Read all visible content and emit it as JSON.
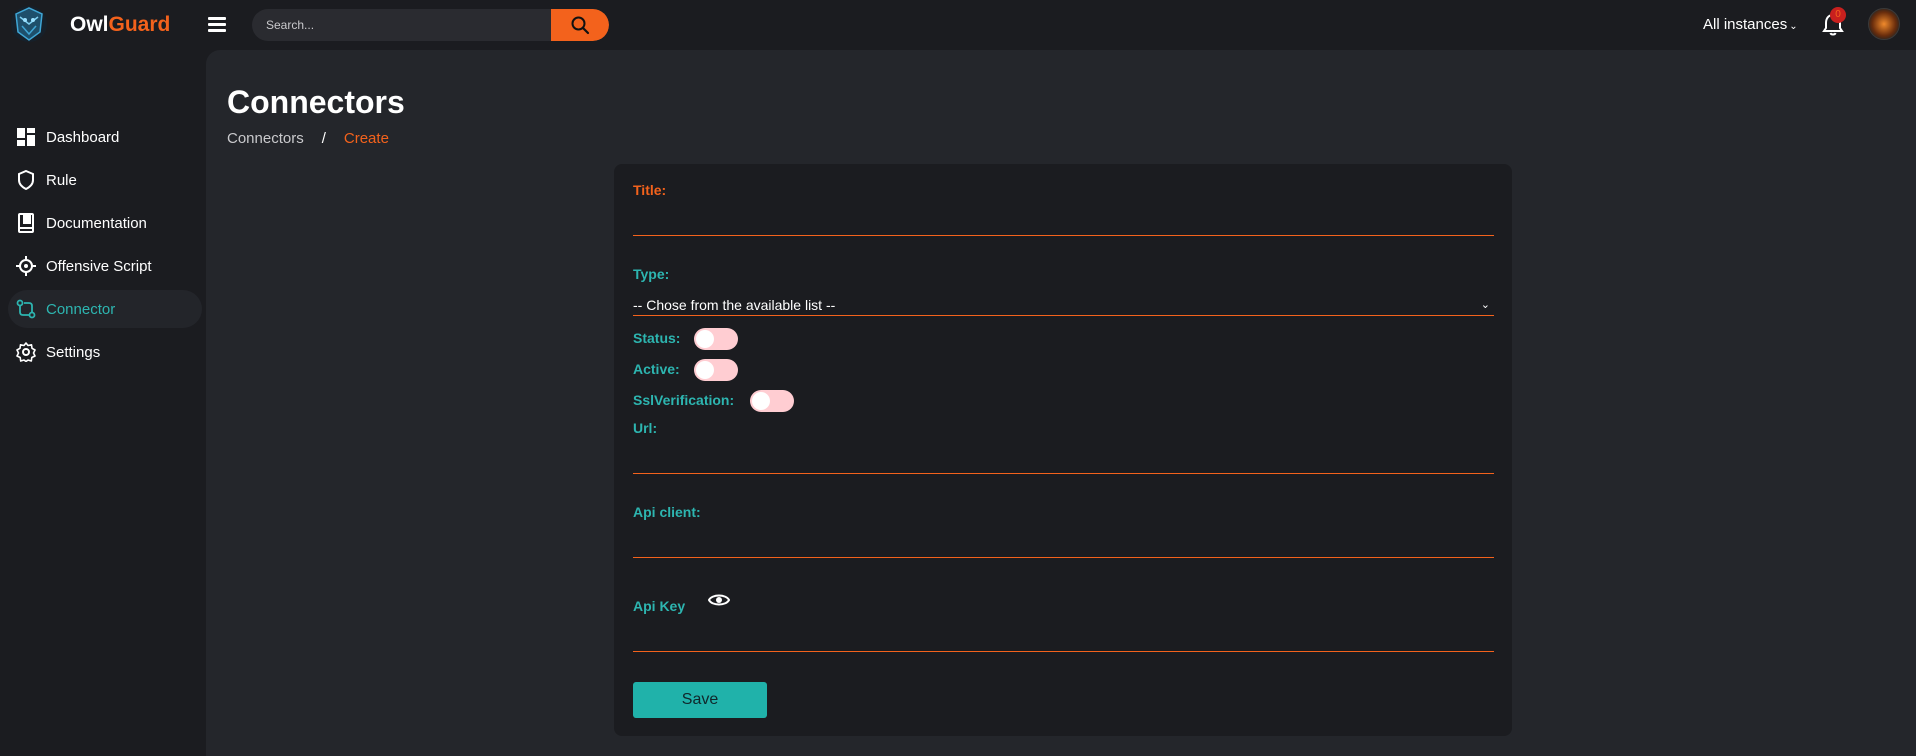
{
  "header": {
    "brand_part1": "Owl",
    "brand_part2": "Guard",
    "search_placeholder": "Search...",
    "instances_label": "All instances",
    "notification_count": "0"
  },
  "sidebar": {
    "items": [
      {
        "label": "Dashboard",
        "icon": "dashboard-icon"
      },
      {
        "label": "Rule",
        "icon": "shield-icon"
      },
      {
        "label": "Documentation",
        "icon": "book-icon"
      },
      {
        "label": "Offensive Script",
        "icon": "crosshair-icon"
      },
      {
        "label": "Connector",
        "icon": "git-compare-icon",
        "active": true
      },
      {
        "label": "Settings",
        "icon": "gear-icon"
      }
    ]
  },
  "page": {
    "title": "Connectors",
    "breadcrumb": {
      "root": "Connectors",
      "separator": "/",
      "current": "Create"
    }
  },
  "form": {
    "title_label": "Title:",
    "title_value": "",
    "type_label": "Type:",
    "type_selected": "-- Chose from the available list --",
    "status_label": "Status:",
    "status_on": false,
    "active_label": "Active:",
    "active_on": false,
    "ssl_label": "SslVerification:",
    "ssl_on": false,
    "url_label": "Url:",
    "url_value": "",
    "api_client_label": "Api client:",
    "api_client_value": "",
    "api_key_label": "Api Key",
    "api_key_value": "",
    "save_label": "Save"
  },
  "colors": {
    "accent": "#f3621c",
    "teal": "#2db5b0",
    "toggle_off": "#ffcdd2",
    "background": "#1b1c20",
    "panel": "#24262b"
  }
}
